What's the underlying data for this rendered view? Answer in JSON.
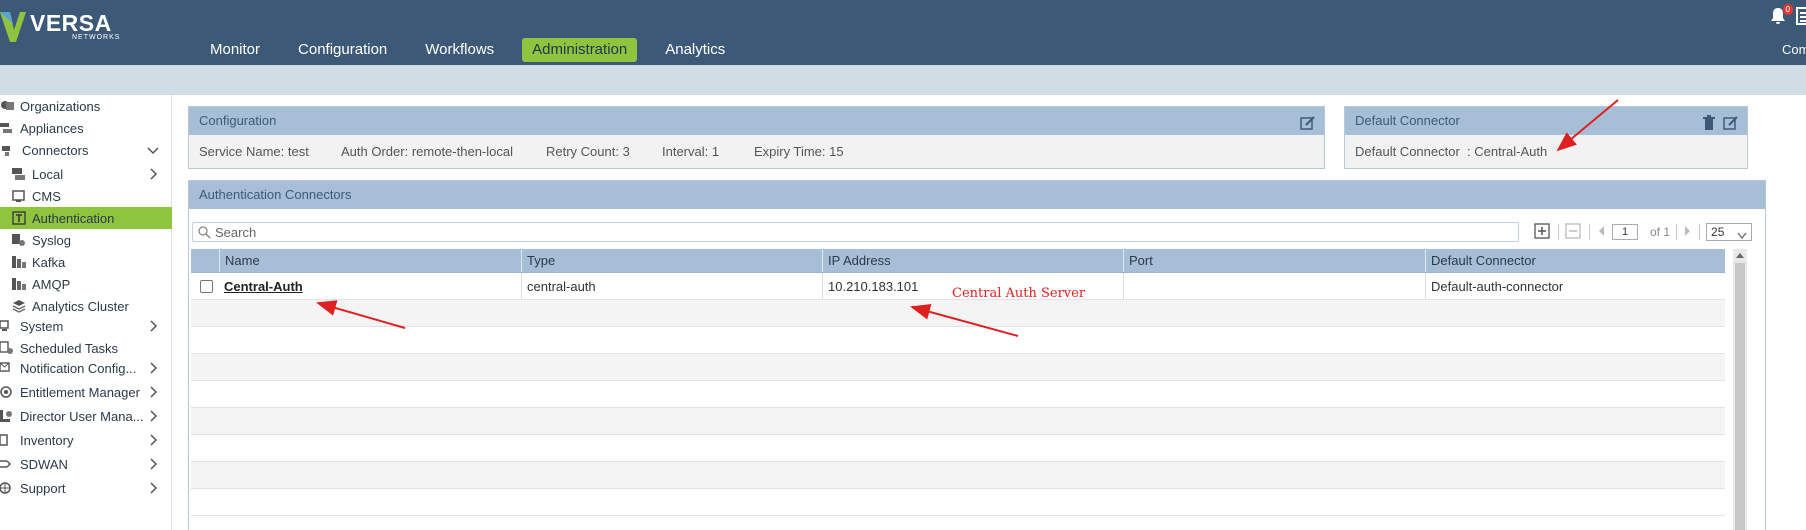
{
  "header": {
    "brand": "VERSA",
    "brand_sub": "NETWORKS",
    "nav": [
      "Monitor",
      "Configuration",
      "Workflows",
      "Administration",
      "Analytics"
    ],
    "active_nav": "Administration",
    "notification_count": "0",
    "user_clip": "Com",
    "colors": {
      "bar": "#3c5a78",
      "accent": "#8fc43f",
      "subbar": "#d1dce4"
    }
  },
  "sidebar": {
    "items": [
      {
        "label": "Organizations",
        "icon": "organizations-icon"
      },
      {
        "label": "Appliances",
        "icon": "appliances-icon"
      },
      {
        "label": "Connectors",
        "icon": "connectors-icon",
        "expanded": true
      },
      {
        "label": "Local",
        "icon": "local-icon"
      },
      {
        "label": "CMS",
        "icon": "cms-icon"
      },
      {
        "label": "Authentication",
        "icon": "authentication-icon",
        "active": true
      },
      {
        "label": "Syslog",
        "icon": "syslog-icon"
      },
      {
        "label": "Kafka",
        "icon": "kafka-icon"
      },
      {
        "label": "AMQP",
        "icon": "amqp-icon"
      },
      {
        "label": "Analytics Cluster",
        "icon": "analytics-cluster-icon"
      },
      {
        "label": "System",
        "icon": "system-icon"
      },
      {
        "label": "Scheduled Tasks",
        "icon": "scheduled-tasks-icon"
      },
      {
        "label": "Notification Config...",
        "icon": "notification-icon"
      },
      {
        "label": "Entitlement Manager",
        "icon": "entitlement-icon"
      },
      {
        "label": "Director User Mana...",
        "icon": "director-user-icon"
      },
      {
        "label": "Inventory",
        "icon": "inventory-icon"
      },
      {
        "label": "SDWAN",
        "icon": "sdwan-icon"
      },
      {
        "label": "Support",
        "icon": "support-icon"
      }
    ]
  },
  "configuration": {
    "title": "Configuration",
    "service_name_label": "Service Name:",
    "service_name": "test",
    "auth_order_label": "Auth Order:",
    "auth_order": "remote-then-local",
    "retry_count_label": "Retry Count:",
    "retry_count": "3",
    "interval_label": "Interval:",
    "interval": "1",
    "expiry_time_label": "Expiry Time:",
    "expiry_time": "15"
  },
  "default_connector": {
    "title": "Default Connector",
    "label": "Default Connector",
    "sep": ":",
    "value": "Central-Auth"
  },
  "auth_connectors": {
    "title": "Authentication Connectors",
    "search_placeholder": "Search",
    "page": "1",
    "of_pages": "of 1",
    "page_size": "25",
    "columns": [
      "Name",
      "Type",
      "IP Address",
      "Port",
      "Default Connector"
    ],
    "rows": [
      {
        "name": "Central-Auth",
        "type": "central-auth",
        "ip": "10.210.183.101",
        "port": "",
        "default": "Default-auth-connector"
      }
    ],
    "annotation": "Central Auth Server"
  }
}
